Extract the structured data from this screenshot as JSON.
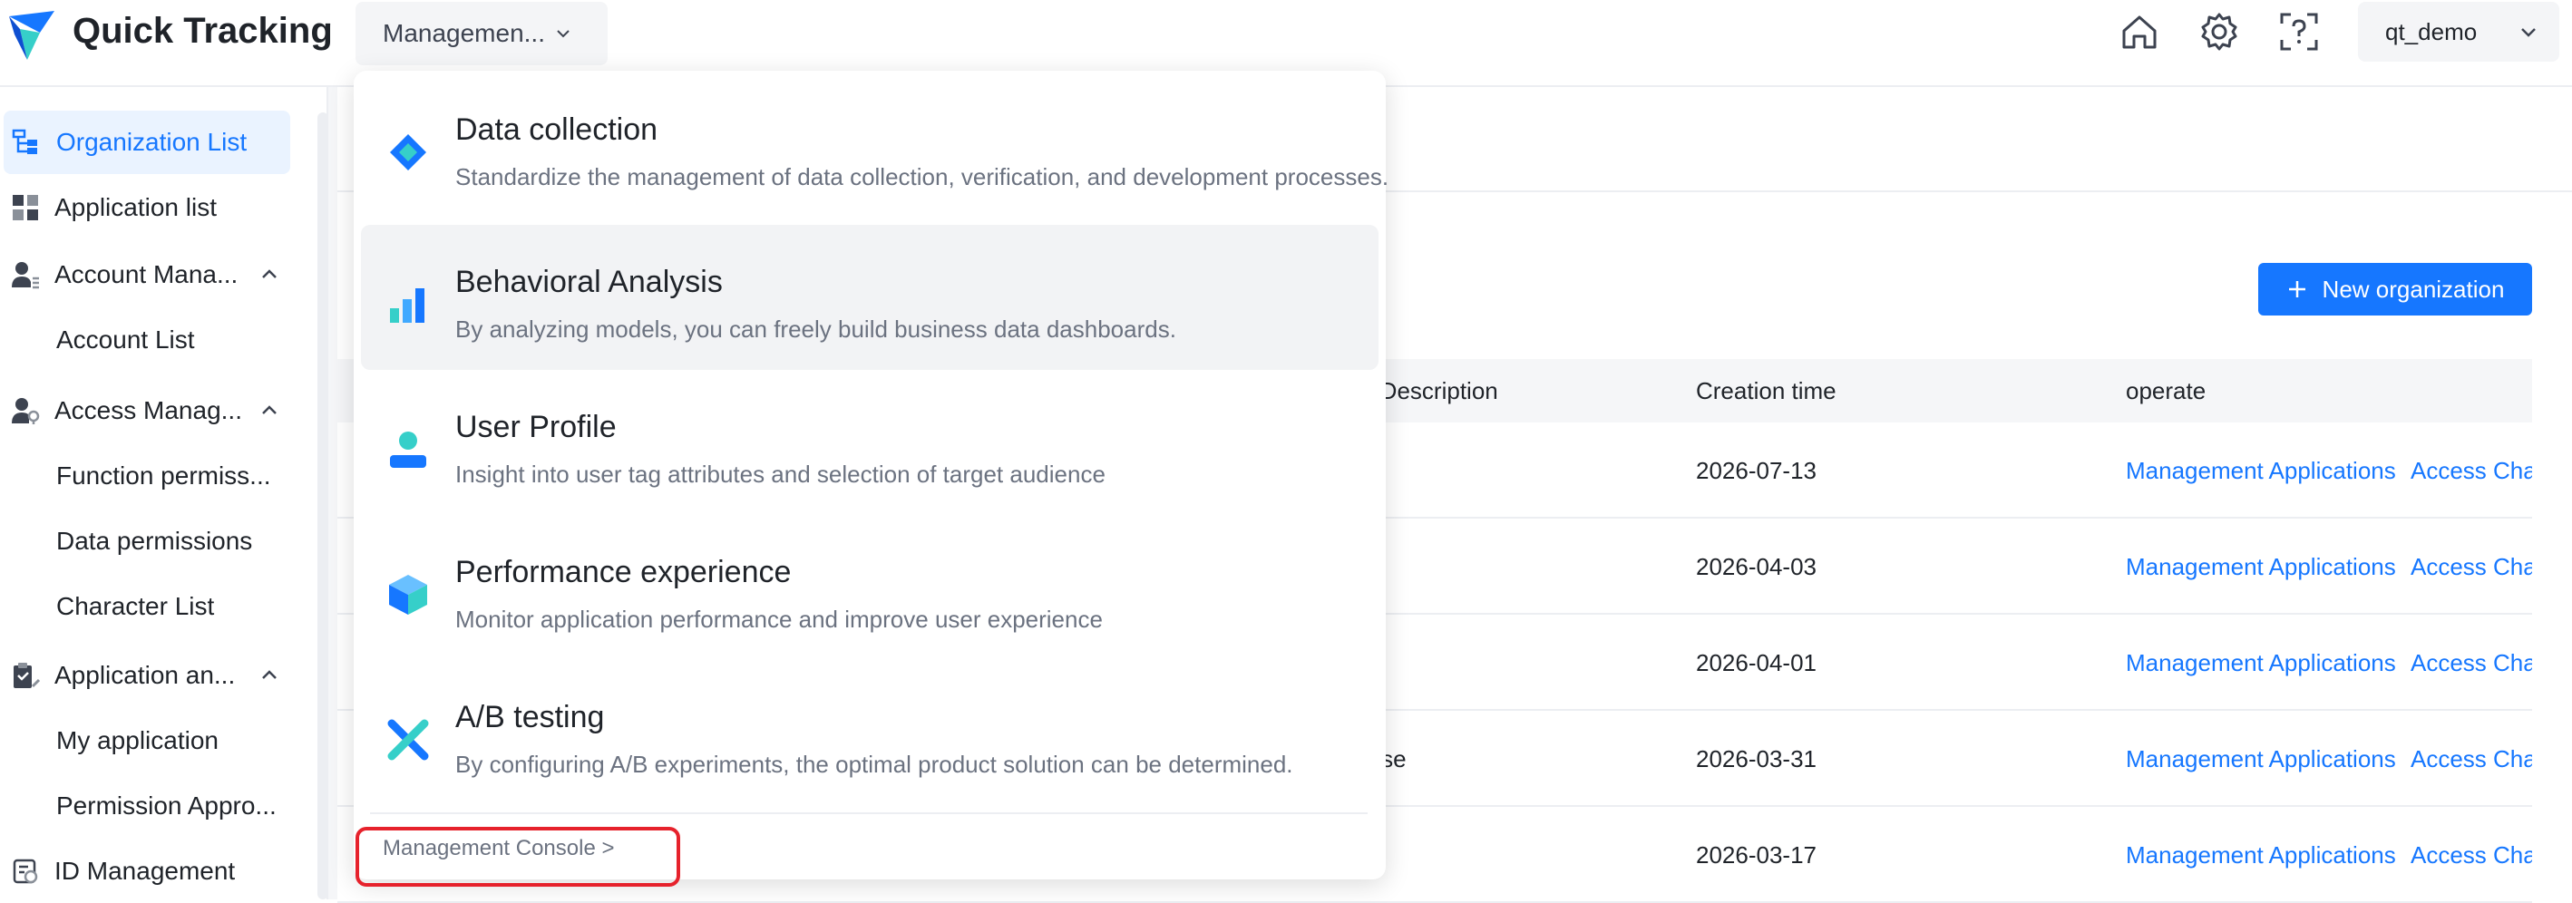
{
  "app": {
    "title": "Quick Tracking"
  },
  "header": {
    "module_select": "Managemen...",
    "user": "qt_demo"
  },
  "sidebar": {
    "items": [
      {
        "label": "Organization List",
        "icon": "org-tree-icon",
        "active": true
      },
      {
        "label": "Application list",
        "icon": "app-grid-icon"
      },
      {
        "label": "Account Mana...",
        "icon": "account-icon",
        "expandable": true
      },
      {
        "label": "Account List",
        "sub": true
      },
      {
        "label": "Access Manag...",
        "icon": "access-icon",
        "expandable": true
      },
      {
        "label": "Function permiss...",
        "sub": true
      },
      {
        "label": "Data permissions",
        "sub": true
      },
      {
        "label": "Character List",
        "sub": true
      },
      {
        "label": "Application an...",
        "icon": "clipboard-icon",
        "expandable": true
      },
      {
        "label": "My application",
        "sub": true
      },
      {
        "label": "Permission Appro...",
        "sub": true
      },
      {
        "label": "ID Management",
        "icon": "id-icon"
      }
    ]
  },
  "toolbar": {
    "new_org_label": "New organization"
  },
  "table": {
    "columns": [
      "n Description",
      "Creation time",
      "operate"
    ],
    "rows": [
      {
        "desc": "",
        "created": "2026-07-13",
        "op1": "Management Applications",
        "op2": "Access Cha"
      },
      {
        "desc": "",
        "created": "2026-04-03",
        "op1": "Management Applications",
        "op2": "Access Cha"
      },
      {
        "desc": "",
        "created": "2026-04-01",
        "op1": "Management Applications",
        "op2": "Access Cha"
      },
      {
        "desc": "erse",
        "created": "2026-03-31",
        "op1": "Management Applications",
        "op2": "Access Cha"
      },
      {
        "desc": "",
        "created": "2026-03-17",
        "op1": "Management Applications",
        "op2": "Access Cha"
      }
    ]
  },
  "dropdown": {
    "items": [
      {
        "title": "Data collection",
        "desc": "Standardize the management of data collection, verification, and development processes.",
        "icon": "data-collection-icon"
      },
      {
        "title": "Behavioral Analysis",
        "desc": "By analyzing models, you can freely build business data dashboards.",
        "icon": "bar-chart-icon"
      },
      {
        "title": "User Profile",
        "desc": "Insight into user tag attributes and selection of target audience",
        "icon": "user-profile-icon"
      },
      {
        "title": "Performance experience",
        "desc": "Monitor application performance and improve user experience",
        "icon": "cube-icon"
      },
      {
        "title": "A/B testing",
        "desc": "By configuring A/B experiments, the optimal product solution can be determined.",
        "icon": "ab-test-icon"
      }
    ],
    "console_link": "Management Console >"
  },
  "colors": {
    "accent": "#1677ff",
    "highlight": "#e6222c"
  }
}
